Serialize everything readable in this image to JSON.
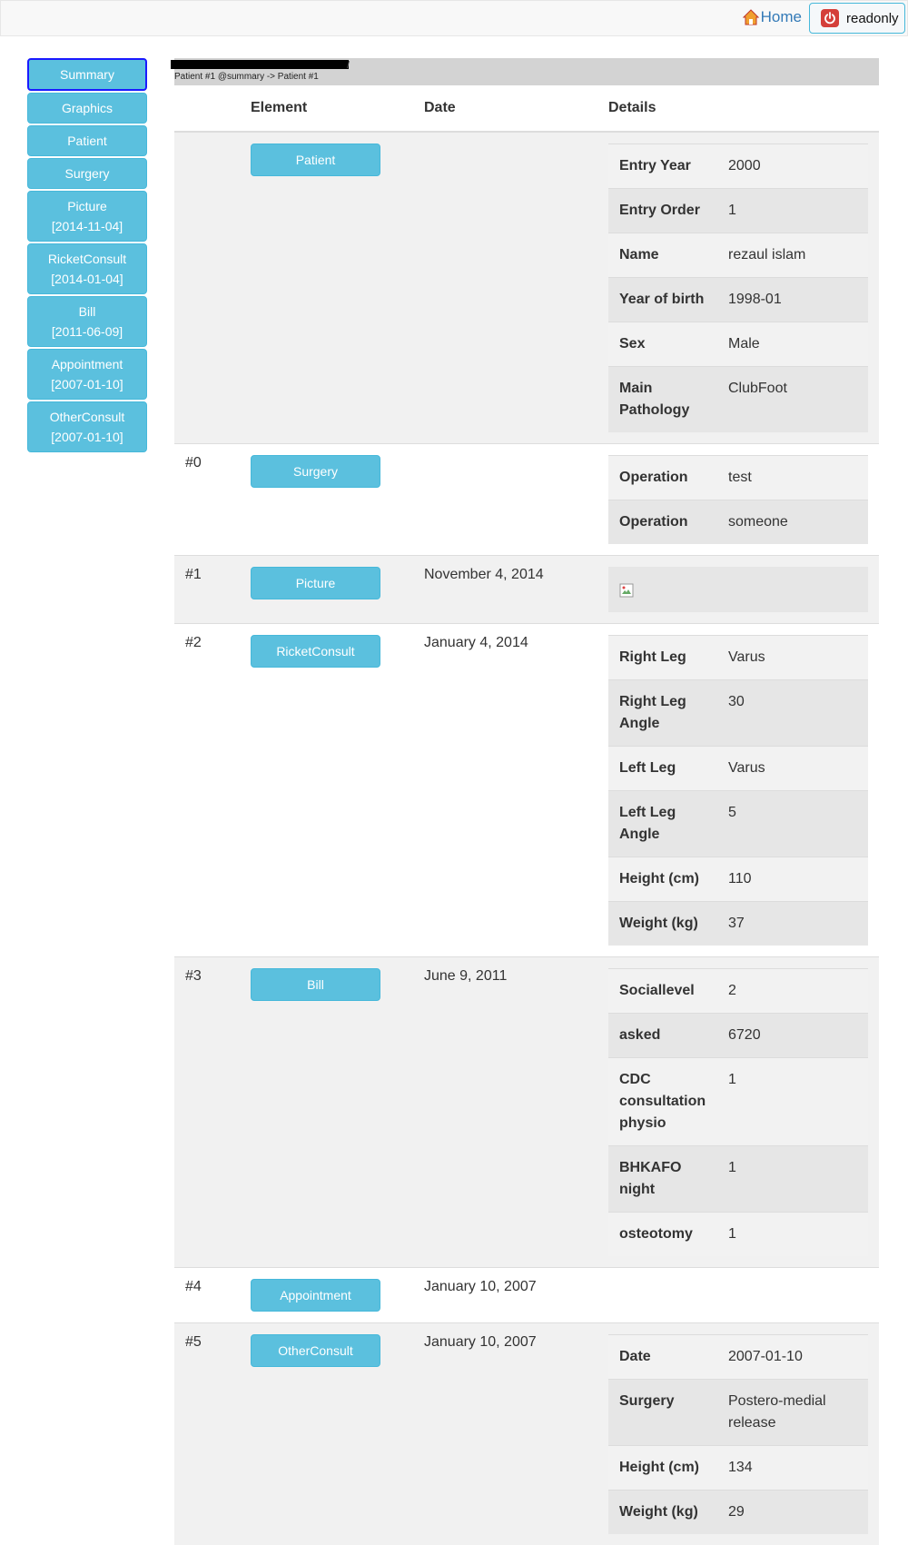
{
  "navbar": {
    "home_label": "Home",
    "readonly_label": "readonly"
  },
  "sidebar": {
    "items": [
      {
        "label": "Summary",
        "sub": ""
      },
      {
        "label": "Graphics",
        "sub": ""
      },
      {
        "label": "Patient",
        "sub": ""
      },
      {
        "label": "Surgery",
        "sub": ""
      },
      {
        "label": "Picture",
        "sub": "[2014-11-04]"
      },
      {
        "label": "RicketConsult",
        "sub": "[2014-01-04]"
      },
      {
        "label": "Bill",
        "sub": "[2011-06-09]"
      },
      {
        "label": "Appointment",
        "sub": "[2007-01-10]"
      },
      {
        "label": "OtherConsult",
        "sub": "[2007-01-10]"
      }
    ]
  },
  "breadcrumb": {
    "tick": "/",
    "text": "Patient #1 @summary -> Patient #1"
  },
  "table": {
    "headers": [
      "",
      "Element",
      "Date",
      "Details"
    ],
    "rows": [
      {
        "index": "",
        "element": "Patient",
        "date": "",
        "details": [
          {
            "k": "Entry Year",
            "v": "2000"
          },
          {
            "k": "Entry Order",
            "v": "1"
          },
          {
            "k": "Name",
            "v": "rezaul islam"
          },
          {
            "k": "Year of birth",
            "v": "1998-01"
          },
          {
            "k": "Sex",
            "v": "Male"
          },
          {
            "k": "Main Pathology",
            "v": "ClubFoot"
          }
        ]
      },
      {
        "index": "#0",
        "element": "Surgery",
        "date": "",
        "details": [
          {
            "k": "Operation",
            "v": "test"
          },
          {
            "k": "Operation",
            "v": "someone"
          }
        ]
      },
      {
        "index": "#1",
        "element": "Picture",
        "date": "November 4, 2014",
        "details": []
      },
      {
        "index": "#2",
        "element": "RicketConsult",
        "date": "January 4, 2014",
        "details": [
          {
            "k": "Right Leg",
            "v": "Varus"
          },
          {
            "k": "Right Leg Angle",
            "v": "30"
          },
          {
            "k": "Left Leg",
            "v": "Varus"
          },
          {
            "k": "Left Leg Angle",
            "v": "5"
          },
          {
            "k": "Height (cm)",
            "v": "110"
          },
          {
            "k": "Weight (kg)",
            "v": "37"
          }
        ]
      },
      {
        "index": "#3",
        "element": "Bill",
        "date": "June 9, 2011",
        "details": [
          {
            "k": "Sociallevel",
            "v": "2"
          },
          {
            "k": "asked",
            "v": "6720"
          },
          {
            "k": "CDC consultation physio",
            "v": "1"
          },
          {
            "k": "BHKAFO night",
            "v": "1"
          },
          {
            "k": "osteotomy",
            "v": "1"
          }
        ]
      },
      {
        "index": "#4",
        "element": "Appointment",
        "date": "January 10, 2007",
        "details": []
      },
      {
        "index": "#5",
        "element": "OtherConsult",
        "date": "January 10, 2007",
        "details": [
          {
            "k": "Date",
            "v": "2007-01-10"
          },
          {
            "k": "Surgery",
            "v": "Postero-medial release"
          },
          {
            "k": "Height (cm)",
            "v": "134"
          },
          {
            "k": "Weight (kg)",
            "v": "29"
          }
        ]
      }
    ]
  }
}
